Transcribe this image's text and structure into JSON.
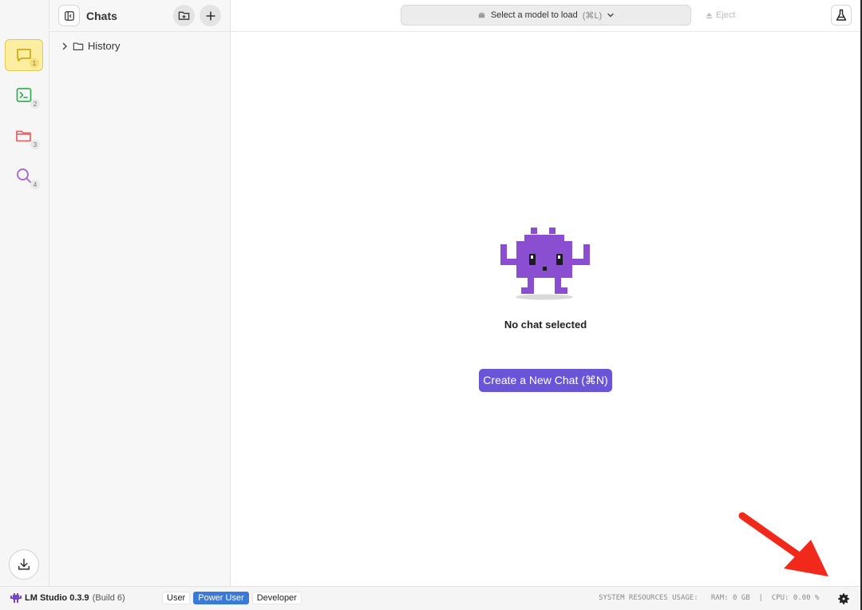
{
  "sidebar": {
    "items": [
      {
        "badge": "1",
        "icon": "chat-icon",
        "color": "#d4a81a"
      },
      {
        "badge": "2",
        "icon": "terminal-icon",
        "color": "#3fae5a"
      },
      {
        "badge": "3",
        "icon": "folder-icon",
        "color": "#e06a6a"
      },
      {
        "badge": "4",
        "icon": "search-icon",
        "color": "#a56ad0"
      }
    ],
    "download_icon": "download-icon"
  },
  "chats": {
    "title": "Chats",
    "history_label": "History"
  },
  "topbar": {
    "model_label": "Select a model to load",
    "model_hint": "(⌘L)",
    "eject_label": "Eject"
  },
  "main": {
    "empty_title": "No chat selected",
    "create_button": "Create a New Chat (⌘N)"
  },
  "footer": {
    "app_name": "LM Studio 0.3.9",
    "build": "(Build 6)",
    "modes": [
      "User",
      "Power User",
      "Developer"
    ],
    "active_mode": "Power User",
    "resources": "SYSTEM RESOURCES USAGE:   RAM: 0 GB  |  CPU: 0.00 %"
  },
  "colors": {
    "accent": "#6a55d8",
    "active_mode": "#3a79d8",
    "annotation_arrow": "#f0291a"
  }
}
